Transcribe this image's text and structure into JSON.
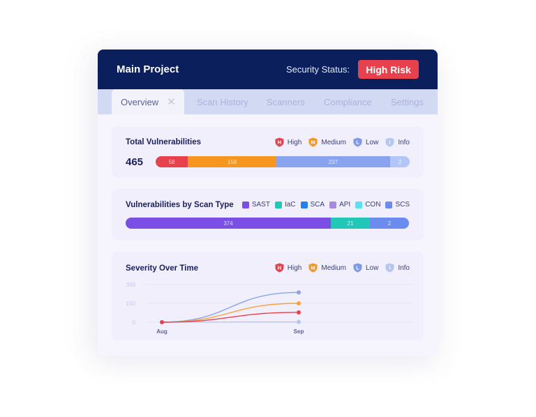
{
  "header": {
    "title": "Main Project",
    "status_label": "Security Status:",
    "status_value": "High Risk",
    "status_color": "#e8414e"
  },
  "tabs": [
    {
      "label": "Overview",
      "active": true,
      "close_icon": "close-icon"
    },
    {
      "label": "Scan History"
    },
    {
      "label": "Scanners"
    },
    {
      "label": "Compliance"
    },
    {
      "label": "Settings"
    }
  ],
  "severity_legend": [
    {
      "letter": "H",
      "label": "High",
      "color": "#e8414e",
      "icon": "shield-icon"
    },
    {
      "letter": "M",
      "label": "Medium",
      "color": "#f7961e",
      "icon": "shield-icon"
    },
    {
      "letter": "L",
      "label": "Low",
      "color": "#7f9be6",
      "icon": "shield-icon"
    },
    {
      "letter": "i",
      "label": "Info",
      "color": "#b4c6f2",
      "icon": "shield-icon"
    }
  ],
  "total_vulnerabilities": {
    "title": "Total Vulnerabilities",
    "total": "465",
    "segments": [
      {
        "label": "High",
        "value": 58,
        "color": "#e8414e"
      },
      {
        "label": "Medium",
        "value": 158,
        "color": "#f7961e"
      },
      {
        "label": "Low",
        "value": 237,
        "color": "#8aa3ee"
      },
      {
        "label": "Info",
        "value": 2,
        "color": "#b4c6f7"
      }
    ]
  },
  "scan_type": {
    "title": "Vulnerabilities by Scan Type",
    "legend": [
      {
        "label": "SAST",
        "color": "#7a4fe4"
      },
      {
        "label": "IaC",
        "color": "#22c7b8"
      },
      {
        "label": "SCA",
        "color": "#2580ea"
      },
      {
        "label": "API",
        "color": "#a68ade"
      },
      {
        "label": "CON",
        "color": "#5de0f5"
      },
      {
        "label": "SCS",
        "color": "#6c8bee"
      }
    ],
    "segments": [
      {
        "label": "SAST",
        "value": 374,
        "color": "#7a4fe4"
      },
      {
        "label": "IaC",
        "value": 21,
        "color": "#22c7b8"
      },
      {
        "label": "SCS",
        "value": 2,
        "color": "#6c8bee"
      }
    ]
  },
  "chart_data": {
    "type": "line",
    "title": "Severity Over Time",
    "x": [
      "Aug",
      "Sep"
    ],
    "yticks": [
      0,
      150,
      300
    ],
    "ylim": [
      0,
      300
    ],
    "grid": true,
    "legend": "top-right",
    "series": [
      {
        "name": "High",
        "values": [
          0,
          78
        ],
        "color": "#e8414e"
      },
      {
        "name": "Medium",
        "values": [
          0,
          150
        ],
        "color": "#f7a13a"
      },
      {
        "name": "Low",
        "values": [
          0,
          237
        ],
        "color": "#8aa3e6"
      },
      {
        "name": "Info",
        "values": [
          0,
          2
        ],
        "color": "#b4c6f2"
      }
    ]
  }
}
